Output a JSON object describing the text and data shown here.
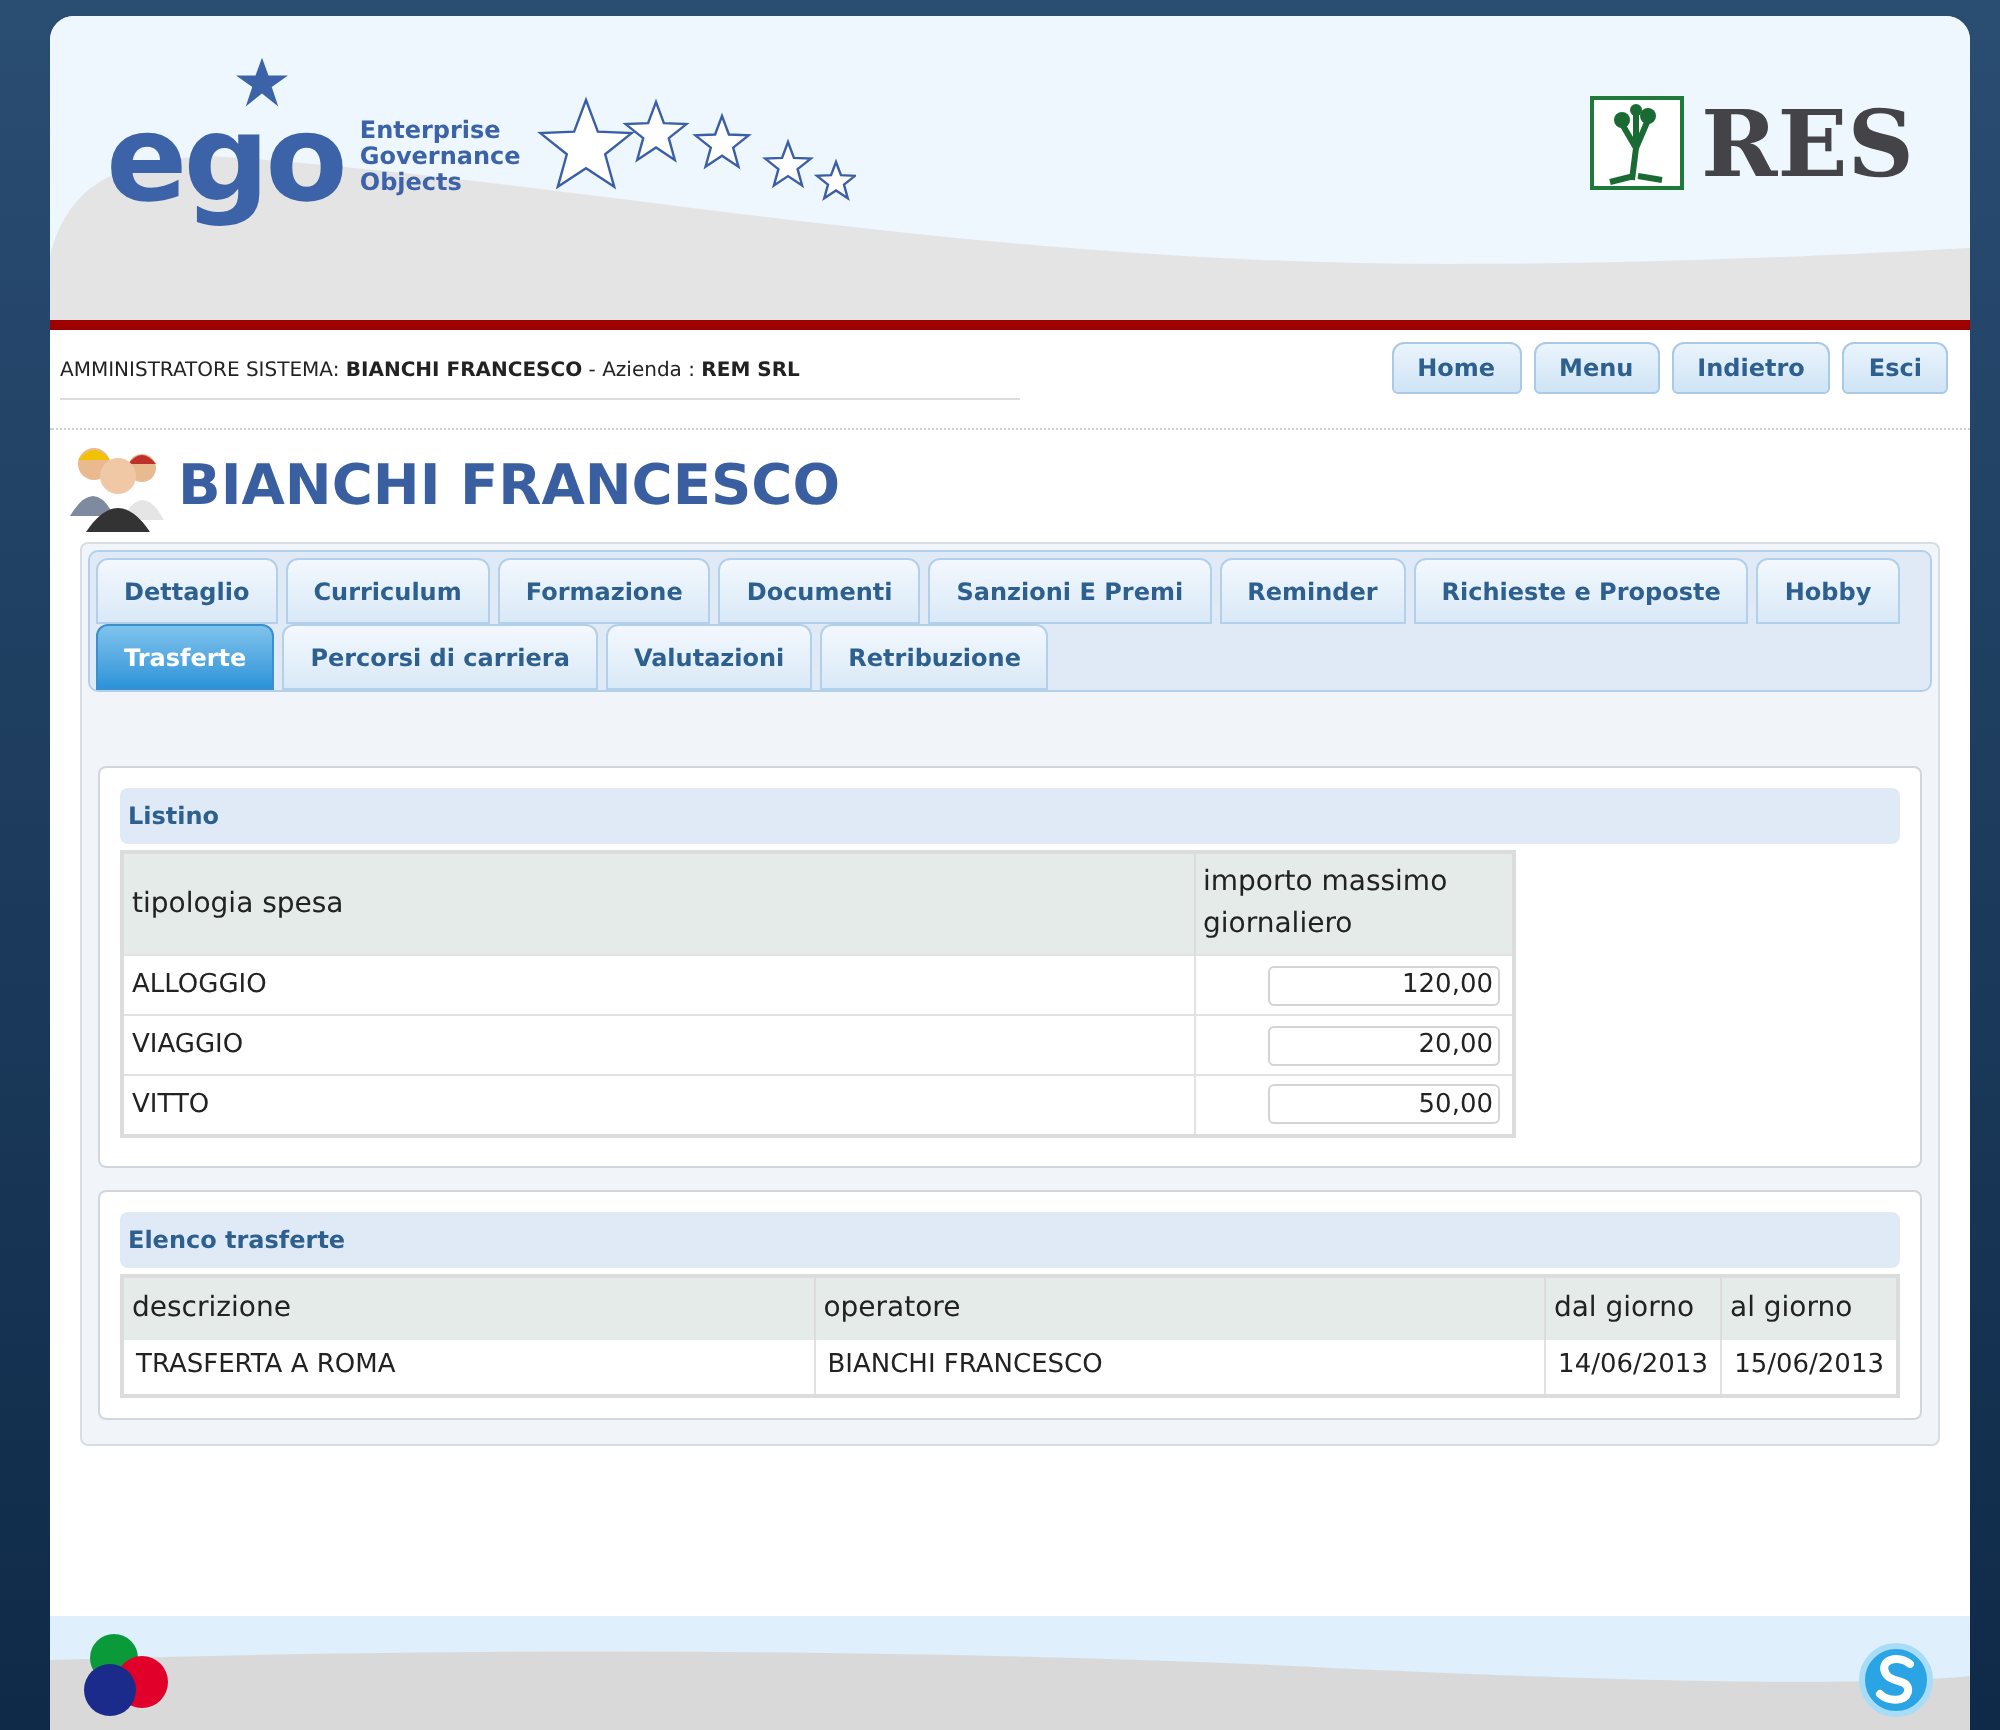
{
  "header": {
    "logo_mark": "ego",
    "logo_tagline": [
      "Enterprise",
      "Governance",
      "Objects"
    ],
    "brand": "RES"
  },
  "info_bar": {
    "role_label": "AMMINISTRATORE SISTEMA:",
    "user": "BIANCHI FRANCESCO",
    "separator": "- Azienda :",
    "company": "REM SRL"
  },
  "nav_buttons": [
    "Home",
    "Menu",
    "Indietro",
    "Esci"
  ],
  "page_title": "BIANCHI FRANCESCO",
  "tab_rows": [
    [
      {
        "label": "Dettaglio",
        "selected": false
      },
      {
        "label": "Curriculum",
        "selected": false
      },
      {
        "label": "Formazione",
        "selected": false
      },
      {
        "label": "Documenti",
        "selected": false
      },
      {
        "label": "Sanzioni E Premi",
        "selected": false
      },
      {
        "label": "Reminder",
        "selected": false
      },
      {
        "label": "Richieste e Proposte",
        "selected": false
      },
      {
        "label": "Hobby",
        "selected": false
      }
    ],
    [
      {
        "label": "Trasferte",
        "selected": true
      },
      {
        "label": "Percorsi di carriera",
        "selected": false
      },
      {
        "label": "Valutazioni",
        "selected": false
      },
      {
        "label": "Retribuzione",
        "selected": false
      }
    ]
  ],
  "listino": {
    "title": "Listino",
    "columns": [
      "tipologia spesa",
      "importo massimo giornaliero"
    ],
    "rows": [
      {
        "type": "ALLOGGIO",
        "amount": "120,00"
      },
      {
        "type": "VIAGGIO",
        "amount": "20,00"
      },
      {
        "type": "VITTO",
        "amount": "50,00"
      }
    ]
  },
  "elenco": {
    "title": "Elenco trasferte",
    "columns": [
      "descrizione",
      "operatore",
      "dal giorno",
      "al giorno"
    ],
    "rows": [
      [
        "TRASFERTA A ROMA",
        "BIANCHI FRANCESCO",
        "14/06/2013",
        "15/06/2013"
      ]
    ]
  }
}
